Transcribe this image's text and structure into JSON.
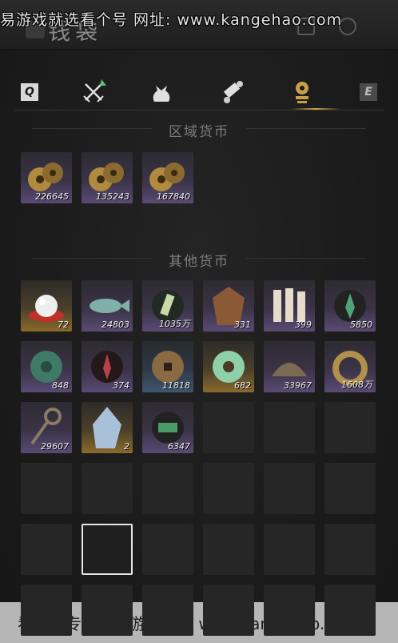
{
  "window": {
    "title": "钱袋"
  },
  "watermarks": {
    "top": "易游戏就选看个号  网址: www.kangehao.com",
    "bottom": "看个号专业网易游戏八年  www.kangehao.com"
  },
  "tabs": {
    "left_key": "Q",
    "right_key": "E",
    "items": [
      {
        "name": "sword-tab",
        "icon": "crossed-swords-icon"
      },
      {
        "name": "bag-tab",
        "icon": "sack-icon"
      },
      {
        "name": "scroll-tab",
        "icon": "scroll-icon"
      },
      {
        "name": "currency-tab",
        "icon": "currency-icon",
        "active": true
      }
    ]
  },
  "sections": {
    "regional": {
      "title": "区域货币"
    },
    "other": {
      "title": "其他货币"
    }
  },
  "regional_items": [
    {
      "count": "226645",
      "icon": "coin-stack-icon",
      "rarity": "rare"
    },
    {
      "count": "135243",
      "icon": "coin-stack-icon",
      "rarity": "rare"
    },
    {
      "count": "167840",
      "icon": "coin-stack-icon",
      "rarity": "rare"
    }
  ],
  "other_items": [
    {
      "count": "72",
      "icon": "pearl-icon",
      "rarity": "gold"
    },
    {
      "count": "24803",
      "icon": "jade-fish-icon",
      "rarity": "rare"
    },
    {
      "count": "1035万",
      "icon": "token-icon",
      "rarity": "rare"
    },
    {
      "count": "331",
      "icon": "bronze-plaque-icon",
      "rarity": "rare"
    },
    {
      "count": "399",
      "icon": "bone-slips-icon",
      "rarity": "rare"
    },
    {
      "count": "5850",
      "icon": "green-spirit-icon",
      "rarity": "rare"
    },
    {
      "count": "848",
      "icon": "jade-stone-icon",
      "rarity": "rare"
    },
    {
      "count": "374",
      "icon": "red-spirit-icon",
      "rarity": "rare"
    },
    {
      "count": "11818",
      "icon": "copper-coin-icon",
      "rarity": "blue"
    },
    {
      "count": "682",
      "icon": "jade-ring-icon",
      "rarity": "gold"
    },
    {
      "count": "33967",
      "icon": "bronze-shell-icon",
      "rarity": "rare"
    },
    {
      "count": "1608万",
      "icon": "coin-string-icon",
      "rarity": "rare"
    },
    {
      "count": "29607",
      "icon": "key-coin-icon",
      "rarity": "rare"
    },
    {
      "count": "2",
      "icon": "crystal-icon",
      "rarity": "gold"
    },
    {
      "count": "6347",
      "icon": "green-ticket-icon",
      "rarity": "rare"
    }
  ],
  "colors": {
    "accent": "#c9a04a",
    "rare": "#5a4a74",
    "gold": "#8a6a2a",
    "blue": "#3e5670"
  }
}
